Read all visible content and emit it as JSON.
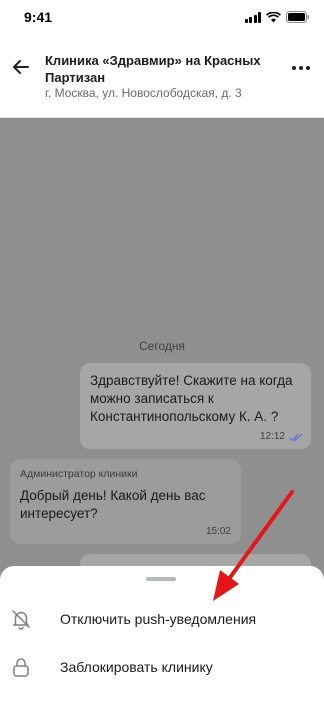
{
  "status_bar": {
    "time": "9:41"
  },
  "header": {
    "title": "Клиника «Здравмир» на Красных Партизан",
    "subtitle": "г. Москва, ул. Новослободская, д. 3"
  },
  "chat": {
    "date_divider": "Сегодня",
    "messages": [
      {
        "direction": "outgoing",
        "text": "Здравствуйте! Скажите на когда можно записаться к Константинопольскому К. А. ?",
        "time": "12:12",
        "status": "read"
      },
      {
        "direction": "incoming",
        "sender": "Администратор клиники",
        "text": "Добрый день! Какой день вас интересует?",
        "time": "15:02"
      }
    ]
  },
  "action_sheet": {
    "items": [
      {
        "icon": "bell-off-icon",
        "label": "Отключить push-уведомления"
      },
      {
        "icon": "lock-icon",
        "label": "Заблокировать клинику"
      }
    ]
  },
  "colors": {
    "overlay": "#8f8f8f",
    "annotation_arrow": "#e3161a",
    "read_check": "#5b6fd6"
  }
}
